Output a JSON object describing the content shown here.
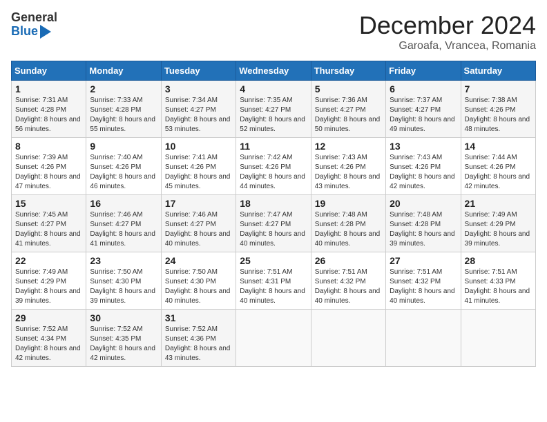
{
  "header": {
    "logo_line1": "General",
    "logo_line2": "Blue",
    "month": "December 2024",
    "location": "Garoafa, Vrancea, Romania"
  },
  "weekdays": [
    "Sunday",
    "Monday",
    "Tuesday",
    "Wednesday",
    "Thursday",
    "Friday",
    "Saturday"
  ],
  "weeks": [
    [
      {
        "day": "1",
        "sunrise": "7:31 AM",
        "sunset": "4:28 PM",
        "daylight": "8 hours and 56 minutes."
      },
      {
        "day": "2",
        "sunrise": "7:33 AM",
        "sunset": "4:28 PM",
        "daylight": "8 hours and 55 minutes."
      },
      {
        "day": "3",
        "sunrise": "7:34 AM",
        "sunset": "4:27 PM",
        "daylight": "8 hours and 53 minutes."
      },
      {
        "day": "4",
        "sunrise": "7:35 AM",
        "sunset": "4:27 PM",
        "daylight": "8 hours and 52 minutes."
      },
      {
        "day": "5",
        "sunrise": "7:36 AM",
        "sunset": "4:27 PM",
        "daylight": "8 hours and 50 minutes."
      },
      {
        "day": "6",
        "sunrise": "7:37 AM",
        "sunset": "4:27 PM",
        "daylight": "8 hours and 49 minutes."
      },
      {
        "day": "7",
        "sunrise": "7:38 AM",
        "sunset": "4:26 PM",
        "daylight": "8 hours and 48 minutes."
      }
    ],
    [
      {
        "day": "8",
        "sunrise": "7:39 AM",
        "sunset": "4:26 PM",
        "daylight": "8 hours and 47 minutes."
      },
      {
        "day": "9",
        "sunrise": "7:40 AM",
        "sunset": "4:26 PM",
        "daylight": "8 hours and 46 minutes."
      },
      {
        "day": "10",
        "sunrise": "7:41 AM",
        "sunset": "4:26 PM",
        "daylight": "8 hours and 45 minutes."
      },
      {
        "day": "11",
        "sunrise": "7:42 AM",
        "sunset": "4:26 PM",
        "daylight": "8 hours and 44 minutes."
      },
      {
        "day": "12",
        "sunrise": "7:43 AM",
        "sunset": "4:26 PM",
        "daylight": "8 hours and 43 minutes."
      },
      {
        "day": "13",
        "sunrise": "7:43 AM",
        "sunset": "4:26 PM",
        "daylight": "8 hours and 42 minutes."
      },
      {
        "day": "14",
        "sunrise": "7:44 AM",
        "sunset": "4:26 PM",
        "daylight": "8 hours and 42 minutes."
      }
    ],
    [
      {
        "day": "15",
        "sunrise": "7:45 AM",
        "sunset": "4:27 PM",
        "daylight": "8 hours and 41 minutes."
      },
      {
        "day": "16",
        "sunrise": "7:46 AM",
        "sunset": "4:27 PM",
        "daylight": "8 hours and 41 minutes."
      },
      {
        "day": "17",
        "sunrise": "7:46 AM",
        "sunset": "4:27 PM",
        "daylight": "8 hours and 40 minutes."
      },
      {
        "day": "18",
        "sunrise": "7:47 AM",
        "sunset": "4:27 PM",
        "daylight": "8 hours and 40 minutes."
      },
      {
        "day": "19",
        "sunrise": "7:48 AM",
        "sunset": "4:28 PM",
        "daylight": "8 hours and 40 minutes."
      },
      {
        "day": "20",
        "sunrise": "7:48 AM",
        "sunset": "4:28 PM",
        "daylight": "8 hours and 39 minutes."
      },
      {
        "day": "21",
        "sunrise": "7:49 AM",
        "sunset": "4:29 PM",
        "daylight": "8 hours and 39 minutes."
      }
    ],
    [
      {
        "day": "22",
        "sunrise": "7:49 AM",
        "sunset": "4:29 PM",
        "daylight": "8 hours and 39 minutes."
      },
      {
        "day": "23",
        "sunrise": "7:50 AM",
        "sunset": "4:30 PM",
        "daylight": "8 hours and 39 minutes."
      },
      {
        "day": "24",
        "sunrise": "7:50 AM",
        "sunset": "4:30 PM",
        "daylight": "8 hours and 40 minutes."
      },
      {
        "day": "25",
        "sunrise": "7:51 AM",
        "sunset": "4:31 PM",
        "daylight": "8 hours and 40 minutes."
      },
      {
        "day": "26",
        "sunrise": "7:51 AM",
        "sunset": "4:32 PM",
        "daylight": "8 hours and 40 minutes."
      },
      {
        "day": "27",
        "sunrise": "7:51 AM",
        "sunset": "4:32 PM",
        "daylight": "8 hours and 40 minutes."
      },
      {
        "day": "28",
        "sunrise": "7:51 AM",
        "sunset": "4:33 PM",
        "daylight": "8 hours and 41 minutes."
      }
    ],
    [
      {
        "day": "29",
        "sunrise": "7:52 AM",
        "sunset": "4:34 PM",
        "daylight": "8 hours and 42 minutes."
      },
      {
        "day": "30",
        "sunrise": "7:52 AM",
        "sunset": "4:35 PM",
        "daylight": "8 hours and 42 minutes."
      },
      {
        "day": "31",
        "sunrise": "7:52 AM",
        "sunset": "4:36 PM",
        "daylight": "8 hours and 43 minutes."
      },
      null,
      null,
      null,
      null
    ]
  ]
}
